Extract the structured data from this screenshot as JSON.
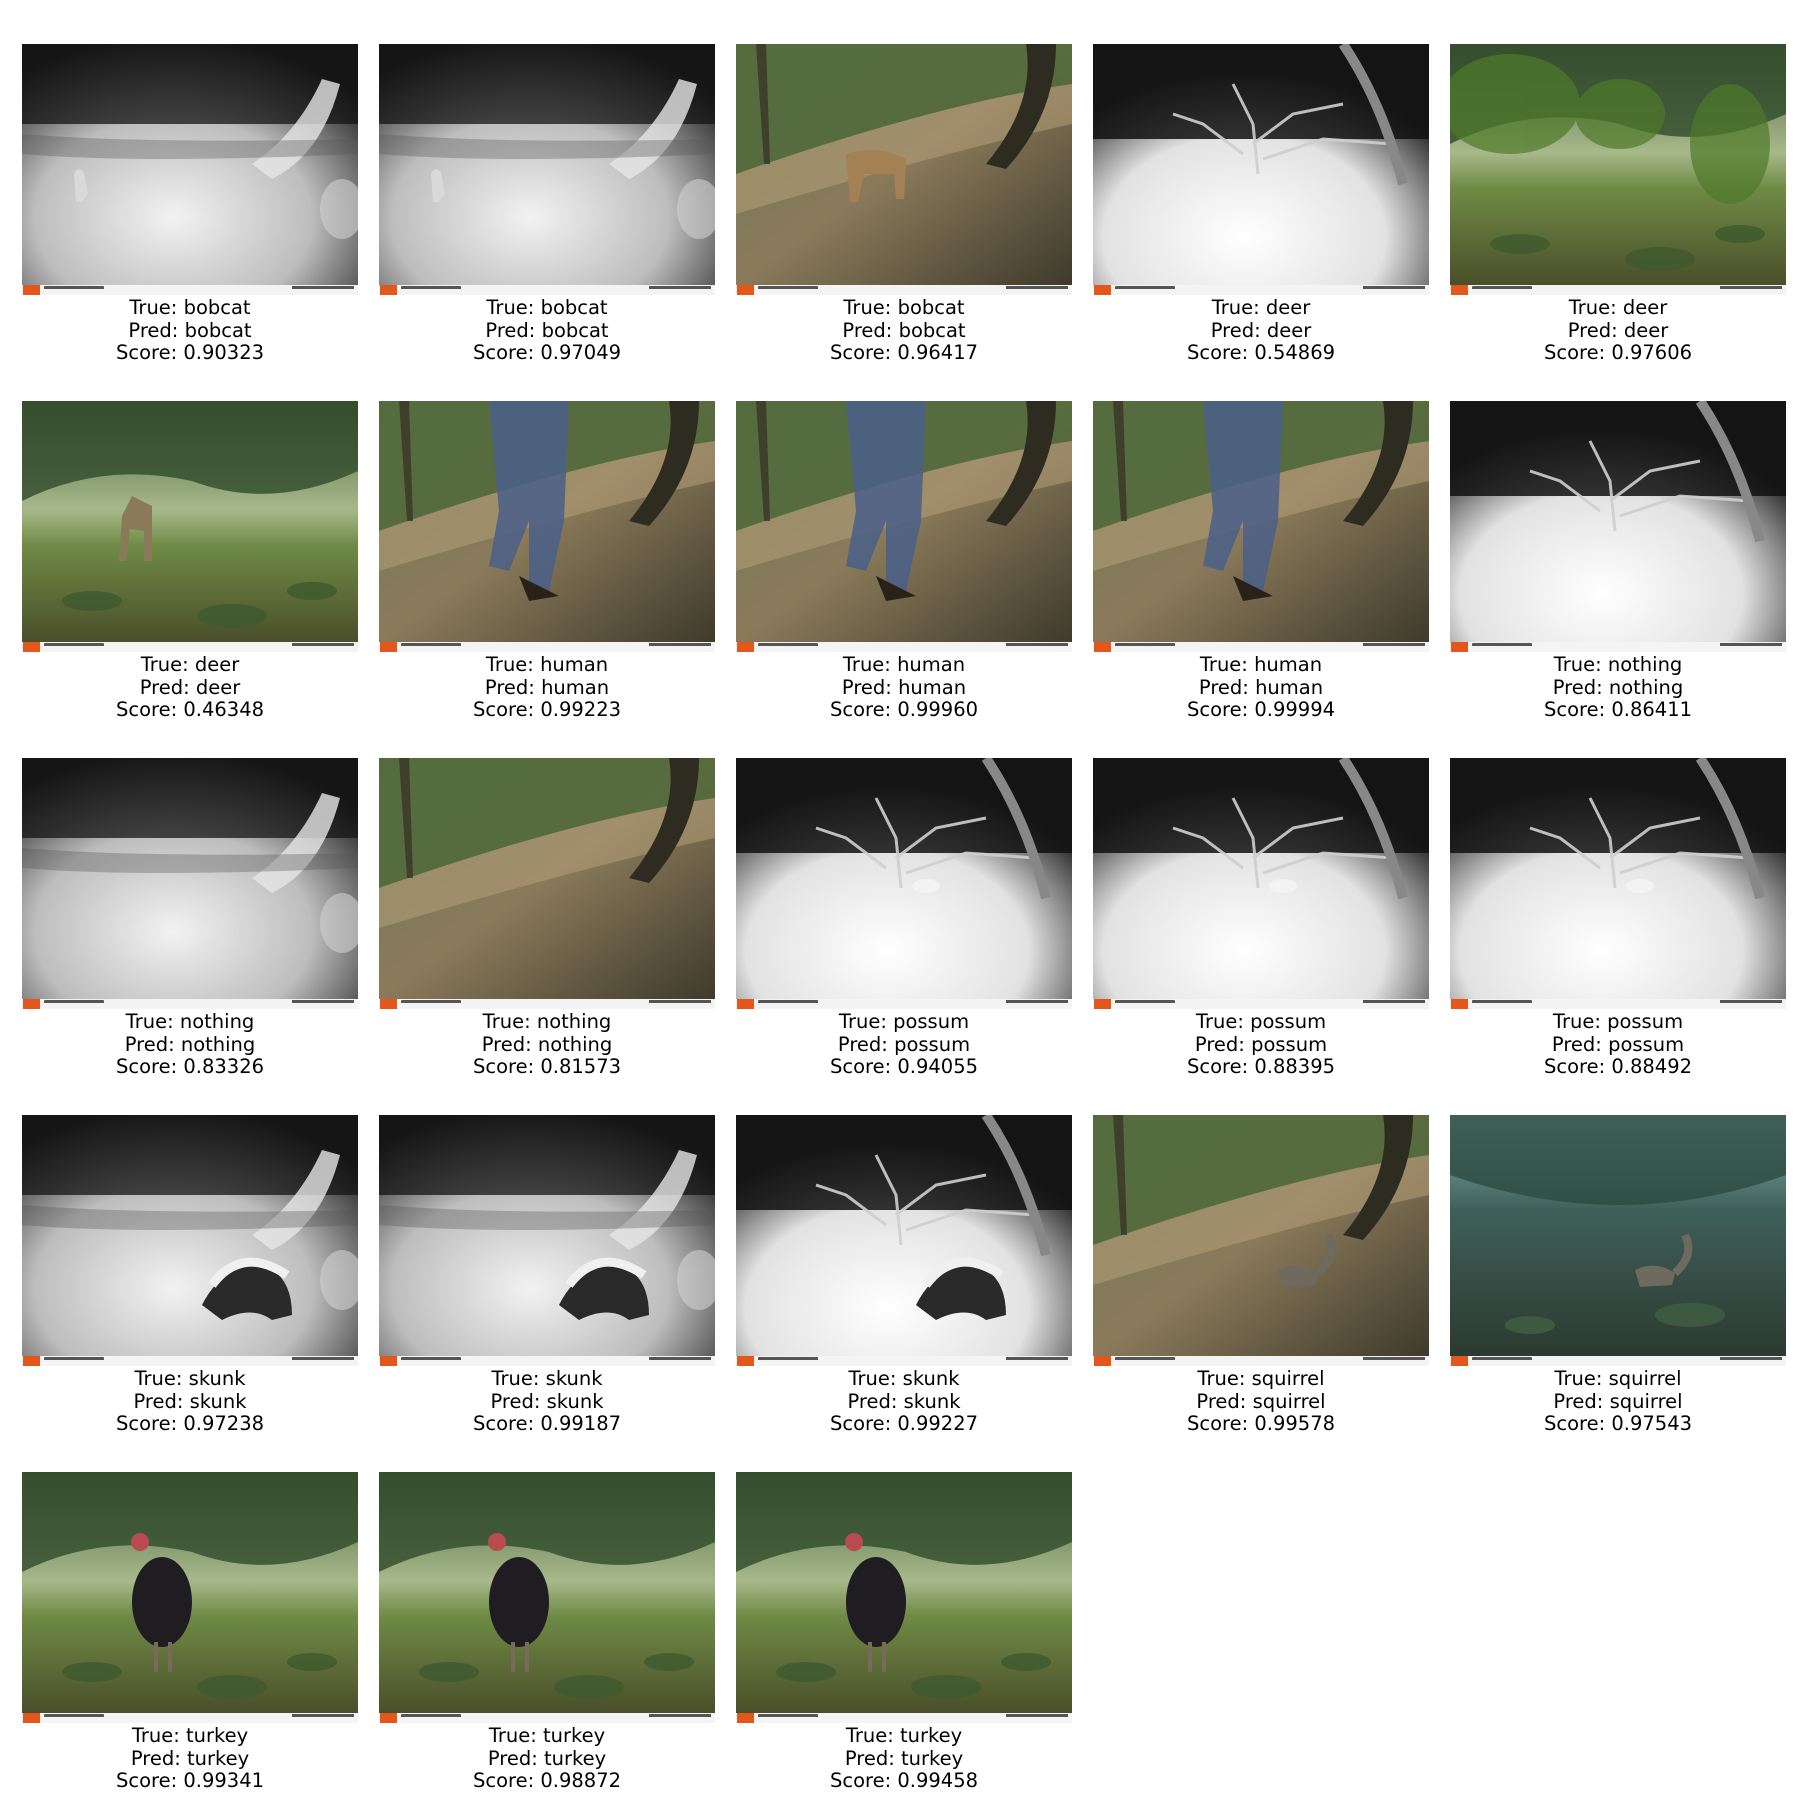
{
  "labels": {
    "true": "True: ",
    "pred": "Pred: ",
    "score": "Score: "
  },
  "panels": [
    {
      "true": "bobcat",
      "pred": "bobcat",
      "score": "0.90323",
      "scene": "night-trail",
      "subject": "bobcat"
    },
    {
      "true": "bobcat",
      "pred": "bobcat",
      "score": "0.97049",
      "scene": "night-trail",
      "subject": "bobcat"
    },
    {
      "true": "bobcat",
      "pred": "bobcat",
      "score": "0.96417",
      "scene": "day-slope",
      "subject": "bobcat"
    },
    {
      "true": "deer",
      "pred": "deer",
      "score": "0.54869",
      "scene": "night-bush",
      "subject": "none"
    },
    {
      "true": "deer",
      "pred": "deer",
      "score": "0.97606",
      "scene": "day-meadow",
      "subject": "leaves"
    },
    {
      "true": "deer",
      "pred": "deer",
      "score": "0.46348",
      "scene": "day-meadow",
      "subject": "deer"
    },
    {
      "true": "human",
      "pred": "human",
      "score": "0.99223",
      "scene": "day-slope",
      "subject": "human"
    },
    {
      "true": "human",
      "pred": "human",
      "score": "0.99960",
      "scene": "day-slope",
      "subject": "human"
    },
    {
      "true": "human",
      "pred": "human",
      "score": "0.99994",
      "scene": "day-slope",
      "subject": "human"
    },
    {
      "true": "nothing",
      "pred": "nothing",
      "score": "0.86411",
      "scene": "night-bush",
      "subject": "none"
    },
    {
      "true": "nothing",
      "pred": "nothing",
      "score": "0.83326",
      "scene": "night-trail",
      "subject": "none"
    },
    {
      "true": "nothing",
      "pred": "nothing",
      "score": "0.81573",
      "scene": "day-slope",
      "subject": "none"
    },
    {
      "true": "possum",
      "pred": "possum",
      "score": "0.94055",
      "scene": "night-bush",
      "subject": "possum"
    },
    {
      "true": "possum",
      "pred": "possum",
      "score": "0.88395",
      "scene": "night-bush",
      "subject": "possum"
    },
    {
      "true": "possum",
      "pred": "possum",
      "score": "0.88492",
      "scene": "night-bush",
      "subject": "possum"
    },
    {
      "true": "skunk",
      "pred": "skunk",
      "score": "0.97238",
      "scene": "night-trail",
      "subject": "skunk"
    },
    {
      "true": "skunk",
      "pred": "skunk",
      "score": "0.99187",
      "scene": "night-trail",
      "subject": "skunk"
    },
    {
      "true": "skunk",
      "pred": "skunk",
      "score": "0.99227",
      "scene": "night-bush",
      "subject": "skunk"
    },
    {
      "true": "squirrel",
      "pred": "squirrel",
      "score": "0.99578",
      "scene": "day-slope",
      "subject": "squirrel"
    },
    {
      "true": "squirrel",
      "pred": "squirrel",
      "score": "0.97543",
      "scene": "dusk-forest",
      "subject": "squirrel"
    },
    {
      "true": "turkey",
      "pred": "turkey",
      "score": "0.99341",
      "scene": "day-meadow",
      "subject": "turkey"
    },
    {
      "true": "turkey",
      "pred": "turkey",
      "score": "0.98872",
      "scene": "day-meadow",
      "subject": "turkey"
    },
    {
      "true": "turkey",
      "pred": "turkey",
      "score": "0.99458",
      "scene": "day-meadow",
      "subject": "turkey"
    }
  ]
}
